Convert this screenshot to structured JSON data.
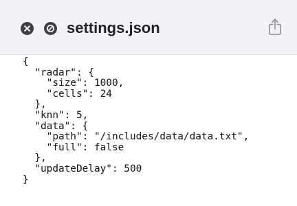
{
  "window": {
    "title": "settings.json"
  },
  "icons": {
    "close": "close-icon",
    "block": "block-icon",
    "share": "share-icon"
  },
  "colors": {
    "titlebar_bg": "#f3f2f7",
    "button_dark": "#3f3f44",
    "share_icon": "#8e8e93",
    "text": "#111111"
  },
  "file": {
    "lines": [
      "{",
      "  \"radar\": {",
      "    \"size\": 1000,",
      "    \"cells\": 24",
      "  },",
      "  \"knn\": 5,",
      "  \"data\": {",
      "    \"path\": \"/includes/data/data.txt\",",
      "    \"full\": false",
      "  },",
      "  \"updateDelay\": 500",
      "}"
    ]
  }
}
